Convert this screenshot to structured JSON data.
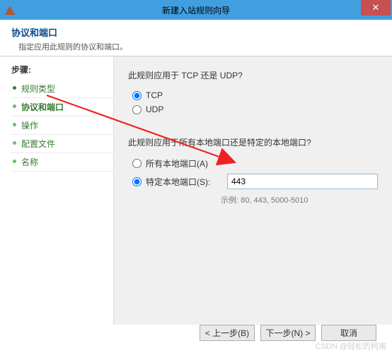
{
  "window": {
    "title": "新建入站规则向导",
    "close_label": "✕"
  },
  "header": {
    "title": "协议和端口",
    "subtitle": "指定应用此规则的协议和端口。"
  },
  "sidebar": {
    "steps_label": "步骤:",
    "items": [
      {
        "label": "规则类型"
      },
      {
        "label": "协议和端口"
      },
      {
        "label": "操作"
      },
      {
        "label": "配置文件"
      },
      {
        "label": "名称"
      }
    ]
  },
  "main": {
    "protocol_question": "此规则应用于 TCP 还是 UDP?",
    "tcp_label": "TCP",
    "udp_label": "UDP",
    "port_question": "此规则应用于所有本地端口还是特定的本地端口?",
    "all_ports_label": "所有本地端口(A)",
    "specific_ports_label": "特定本地端口(S):",
    "port_value": "443",
    "port_hint": "示例: 80, 443, 5000-5010"
  },
  "footer": {
    "back_label": "< 上一步(B)",
    "next_label": "下一步(N) >",
    "cancel_label": "取消"
  },
  "watermark": "CSDN @轻松的柯南"
}
